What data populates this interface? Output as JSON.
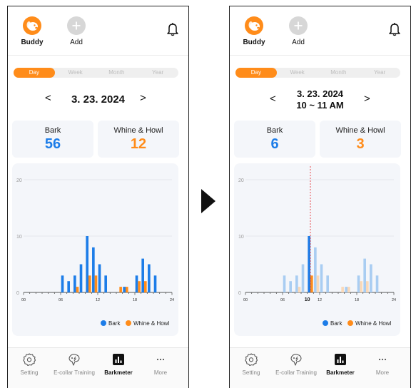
{
  "screens": [
    {
      "id": "left",
      "pet_name": "Buddy",
      "add_label": "Add",
      "periods": [
        "Day",
        "Week",
        "Month",
        "Year"
      ],
      "active_period": "Day",
      "date_line1": "3. 23. 2024",
      "date_line2": "",
      "prev_symbol": "<",
      "next_symbol": ">",
      "bark_label": "Bark",
      "bark_value": "56",
      "whine_label": "Whine & Howl",
      "whine_value": "12"
    },
    {
      "id": "right",
      "pet_name": "Buddy",
      "add_label": "Add",
      "periods": [
        "Day",
        "Week",
        "Month",
        "Year"
      ],
      "active_period": "Day",
      "date_line1": "3. 23. 2024",
      "date_line2": "10 ~ 11 AM",
      "prev_symbol": "<",
      "next_symbol": ">",
      "bark_label": "Bark",
      "bark_value": "6",
      "whine_label": "Whine & Howl",
      "whine_value": "3"
    }
  ],
  "nav": {
    "setting": "Setting",
    "ecollar": "E-collar Training",
    "barkmeter": "Barkmeter",
    "more": "More"
  },
  "icons": {
    "avatar": "dog-face-icon",
    "add": "plus-icon",
    "bell": "bell-icon",
    "setting": "gear-icon",
    "ecollar": "ecollar-icon",
    "barkmeter": "bar-chart-icon",
    "more": "more-dots-icon"
  },
  "colors": {
    "bark": "#1d7de8",
    "whine": "#ff8c1a",
    "bark_dim": "#a9cdf2",
    "whine_dim": "#fad9b8",
    "accent": "#ff8c1a"
  },
  "chart_data": [
    {
      "type": "bar",
      "x": [
        0,
        1,
        2,
        3,
        4,
        5,
        6,
        7,
        8,
        9,
        10,
        11,
        12,
        13,
        14,
        15,
        16,
        17,
        18,
        19,
        20,
        21,
        22,
        23
      ],
      "x_tick_labels": [
        {
          "x": 0,
          "label": "00"
        },
        {
          "x": 6,
          "label": "06"
        },
        {
          "x": 12,
          "label": "12"
        },
        {
          "x": 18,
          "label": "18"
        },
        {
          "x": 24,
          "label": "24"
        }
      ],
      "y_ticks": [
        0,
        10,
        20
      ],
      "ylim": [
        0,
        20
      ],
      "series": [
        {
          "name": "Bark",
          "values": [
            0,
            0,
            0,
            0,
            0,
            0,
            3,
            2,
            3,
            5,
            10,
            8,
            5,
            3,
            0,
            0,
            1,
            0,
            3,
            6,
            5,
            3,
            0,
            0
          ]
        },
        {
          "name": "Whine & Howl",
          "values": [
            0,
            0,
            0,
            0,
            0,
            0,
            0,
            0,
            1,
            0,
            3,
            3,
            0,
            0,
            0,
            1,
            1,
            0,
            2,
            2,
            0,
            0,
            0,
            0
          ]
        }
      ],
      "legend": "bottom-right",
      "grid": true,
      "highlight_hour": null
    },
    {
      "type": "bar",
      "x": [
        0,
        1,
        2,
        3,
        4,
        5,
        6,
        7,
        8,
        9,
        10,
        11,
        12,
        13,
        14,
        15,
        16,
        17,
        18,
        19,
        20,
        21,
        22,
        23
      ],
      "x_tick_labels": [
        {
          "x": 0,
          "label": "00"
        },
        {
          "x": 6,
          "label": "06"
        },
        {
          "x": 10,
          "label": "10"
        },
        {
          "x": 12,
          "label": "12"
        },
        {
          "x": 18,
          "label": "18"
        },
        {
          "x": 24,
          "label": "24"
        }
      ],
      "y_ticks": [
        0,
        10,
        20
      ],
      "ylim": [
        0,
        20
      ],
      "series": [
        {
          "name": "Bark",
          "values": [
            0,
            0,
            0,
            0,
            0,
            0,
            3,
            2,
            3,
            5,
            10,
            8,
            5,
            3,
            0,
            0,
            1,
            0,
            3,
            6,
            5,
            3,
            0,
            0
          ]
        },
        {
          "name": "Whine & Howl",
          "values": [
            0,
            0,
            0,
            0,
            0,
            0,
            0,
            0,
            1,
            0,
            3,
            3,
            0,
            0,
            0,
            1,
            1,
            0,
            2,
            2,
            0,
            0,
            0,
            0
          ]
        }
      ],
      "legend": "bottom-right",
      "grid": true,
      "highlight_hour": 10
    }
  ]
}
